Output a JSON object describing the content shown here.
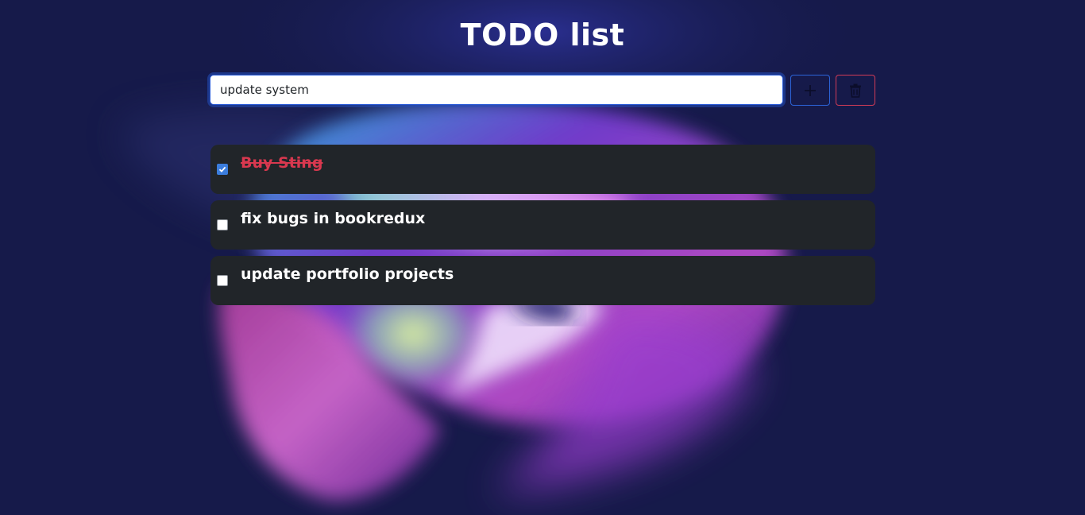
{
  "page": {
    "title": "TODO list"
  },
  "form": {
    "input_value": "update system",
    "add_icon": "plus-icon",
    "delete_icon": "trash-icon"
  },
  "todos": [
    {
      "text": "Buy Sting",
      "done": true
    },
    {
      "text": "fix bugs in bookredux",
      "done": false
    },
    {
      "text": "update portfolio projects",
      "done": false
    }
  ],
  "colors": {
    "background": "#161a4a",
    "card": "#212529",
    "accent_blue": "#2c64d9",
    "accent_red": "#d23b57",
    "done_text": "#d9384f",
    "checkbox_checked": "#3b7ddd"
  }
}
